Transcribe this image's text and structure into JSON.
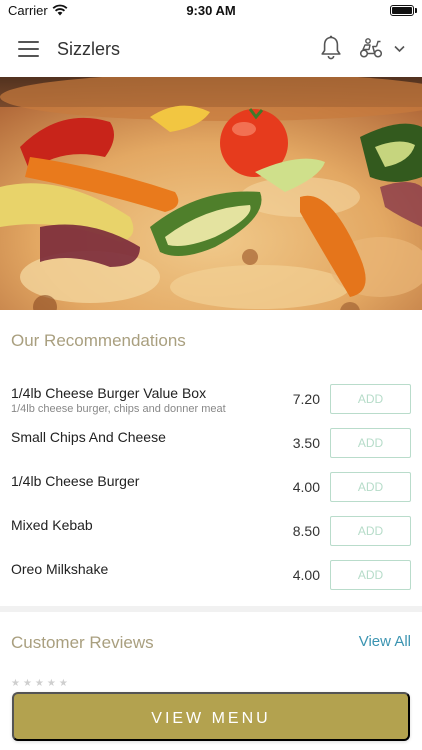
{
  "status_bar": {
    "carrier": "Carrier",
    "time": "9:30 AM"
  },
  "header": {
    "title": "Sizzlers",
    "menu_icon": "hamburger-menu-icon",
    "notification_icon": "bell-icon",
    "delivery_icon": "moped-icon",
    "dropdown_icon": "chevron-down-icon"
  },
  "hero": {
    "image": "vegetable pizza photo"
  },
  "recommendations": {
    "title": "Our Recommendations",
    "items": [
      {
        "name": "1/4lb Cheese Burger Value Box",
        "description": "1/4lb cheese burger, chips and donner meat",
        "price": "7.20",
        "button": "ADD"
      },
      {
        "name": "Small Chips And Cheese",
        "description": "",
        "price": "3.50",
        "button": "ADD"
      },
      {
        "name": "1/4lb Cheese Burger",
        "description": "",
        "price": "4.00",
        "button": "ADD"
      },
      {
        "name": "Mixed Kebab",
        "description": "",
        "price": "8.50",
        "button": "ADD"
      },
      {
        "name": "Oreo Milkshake",
        "description": "",
        "price": "4.00",
        "button": "ADD"
      }
    ]
  },
  "reviews": {
    "title": "Customer Reviews",
    "view_all": "View All"
  },
  "bottom": {
    "view_menu": "VIEW MENU"
  },
  "colors": {
    "accent_gold": "#b3a24f",
    "section_title": "#a99f7f",
    "link_blue": "#3b94b1",
    "add_border": "#b9dccb"
  }
}
